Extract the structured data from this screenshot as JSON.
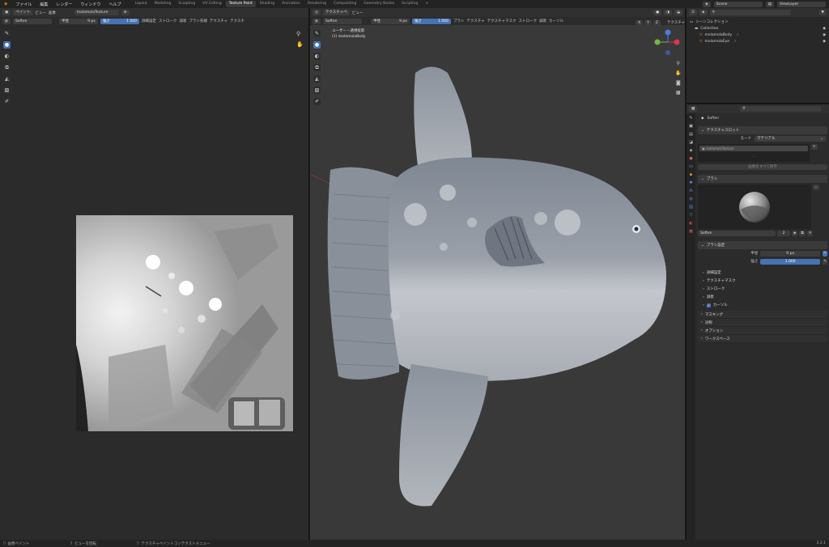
{
  "topbar": {
    "menus": [
      "ファイル",
      "編集",
      "レンダー",
      "ウィンドウ",
      "ヘルプ"
    ],
    "workspaces": [
      "Layout",
      "Modeling",
      "Sculpting",
      "UV Editing",
      "Texture Paint",
      "Shading",
      "Animation",
      "Rendering",
      "Compositing",
      "Geometry Nodes",
      "Scripting"
    ],
    "active_workspace": "Texture Paint",
    "add_tab": "+",
    "scene": "Scene",
    "view_layer": "ViewLayer"
  },
  "image_editor": {
    "mode": "ペイント",
    "view_menu": "ビュー",
    "image_menu": "画像",
    "image_name": "molamolaTexture",
    "brush_name": "Soften",
    "radius_label": "半径",
    "radius_value": "9 px",
    "strength_label": "強さ",
    "strength_value": "1.000",
    "settings": [
      "詳細設定",
      "ストローク",
      "減衰",
      "ブラシ先端",
      "テクスチャ",
      "テクスチ"
    ]
  },
  "viewport3d": {
    "mode": "テクスチャペ",
    "view_menu": "ビュー",
    "brush_name": "Soften",
    "radius_label": "半径",
    "radius_value": "9 px",
    "strength_label": "強さ",
    "strength_value": "1.000",
    "settings": [
      "ブラシ",
      "テクスチャ",
      "テクスチャマスク",
      "ストローク",
      "減衰",
      "カーソル"
    ],
    "axis_labels": [
      "X",
      "Y",
      "Z"
    ],
    "header_right": "テクスチャ",
    "overlay_line1": "ユーザー・透視投影",
    "overlay_line2": "(1) molamolaBody"
  },
  "outliner": {
    "root": "シーンコレクション",
    "collection": "Collection",
    "objects": [
      "molamolaBody",
      "molamolaEye"
    ]
  },
  "properties": {
    "brush_name": "Soften",
    "texture_slot_header": "テクスチャスロット",
    "mode_label": "モード",
    "mode_value": "マテリアル",
    "slot_item": "molamolaTexture",
    "save_all_button": "画像をすべて保存",
    "brush_panel": "ブラシ",
    "brush_field": "Soften",
    "brush_users": "2",
    "brush_settings_header": "ブラシ設定",
    "radius_label": "半径",
    "radius_value": "9 px",
    "strength_label": "強さ",
    "strength_value": "1.000",
    "sub_panels": [
      "詳細設定",
      "テクスチャマスク",
      "ストローク",
      "減衰",
      "カーソル"
    ],
    "collapsed_panels": [
      "マスキング",
      "対称",
      "オプション",
      "ワークスペース"
    ]
  },
  "statusbar": {
    "items": [
      "画像ペイント",
      "ビューを回転",
      "テクスチャペイントコンテクストメニュー"
    ],
    "version": "3.2.1"
  },
  "colors": {
    "accent": "#4772b3",
    "viewport_bg": "#393939",
    "panel_bg": "#2b2b2b"
  }
}
